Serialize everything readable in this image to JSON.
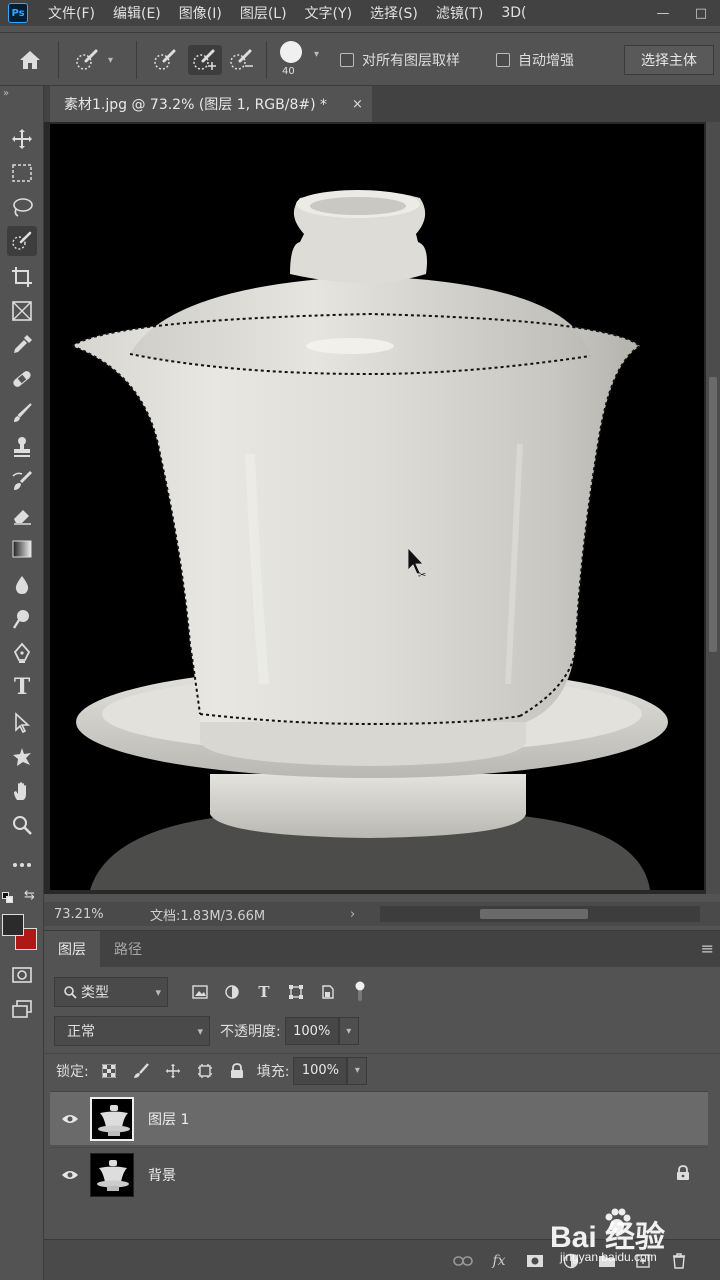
{
  "app": {
    "logo_text": "Ps",
    "menu": [
      "文件(F)",
      "编辑(E)",
      "图像(I)",
      "图层(L)",
      "文字(Y)",
      "选择(S)",
      "滤镜(T)",
      "3D("
    ],
    "window_controls": [
      "—",
      "□"
    ]
  },
  "options_bar": {
    "brush_size": "40",
    "sample_all_layers_label": "对所有图层取样",
    "auto_enhance_label": "自动增强",
    "select_subject_label": "选择主体"
  },
  "toolbar": {
    "tools": [
      "move-tool",
      "marquee-tool",
      "lasso-tool",
      "quick-selection-tool",
      "crop-tool",
      "frame-tool",
      "eyedropper-tool",
      "healing-brush-tool",
      "brush-tool",
      "clone-stamp-tool",
      "history-brush-tool",
      "eraser-tool",
      "gradient-tool",
      "blur-tool",
      "dodge-tool",
      "pen-tool",
      "type-tool",
      "path-selection-tool",
      "shape-tool",
      "hand-tool",
      "zoom-tool",
      "more-tools"
    ],
    "active_tool": "quick-selection-tool",
    "type_glyph": "T",
    "foreground_color": "#2b2b2b",
    "background_color": "#b01818"
  },
  "document": {
    "tab_title": "素材1.jpg @ 73.2% (图层 1, RGB/8#) *",
    "close_glyph": "×"
  },
  "status_bar": {
    "zoom": "73.21%",
    "doc_size": "文档:1.83M/3.66M",
    "arrow": "›"
  },
  "layers_panel": {
    "tabs": [
      "图层",
      "路径"
    ],
    "active_tab": 0,
    "menu_glyph": "≡",
    "filter_type": "类型",
    "blend_mode": "正常",
    "opacity_label": "不透明度:",
    "opacity": "100%",
    "lock_label": "锁定:",
    "fill_label": "填充:",
    "fill": "100%",
    "layers": [
      {
        "name": "图层 1",
        "visible": true,
        "selected": true,
        "locked": false
      },
      {
        "name": "背景",
        "visible": true,
        "selected": false,
        "locked": true
      }
    ],
    "bottom_icons": [
      "link-icon",
      "fx-icon",
      "mask-icon",
      "adjustment-icon",
      "group-icon",
      "new-layer-icon",
      "trash-icon"
    ],
    "fx_text": "fx"
  },
  "watermark": {
    "text": "Bai 经验",
    "url": "jingyan.baidu.com"
  }
}
